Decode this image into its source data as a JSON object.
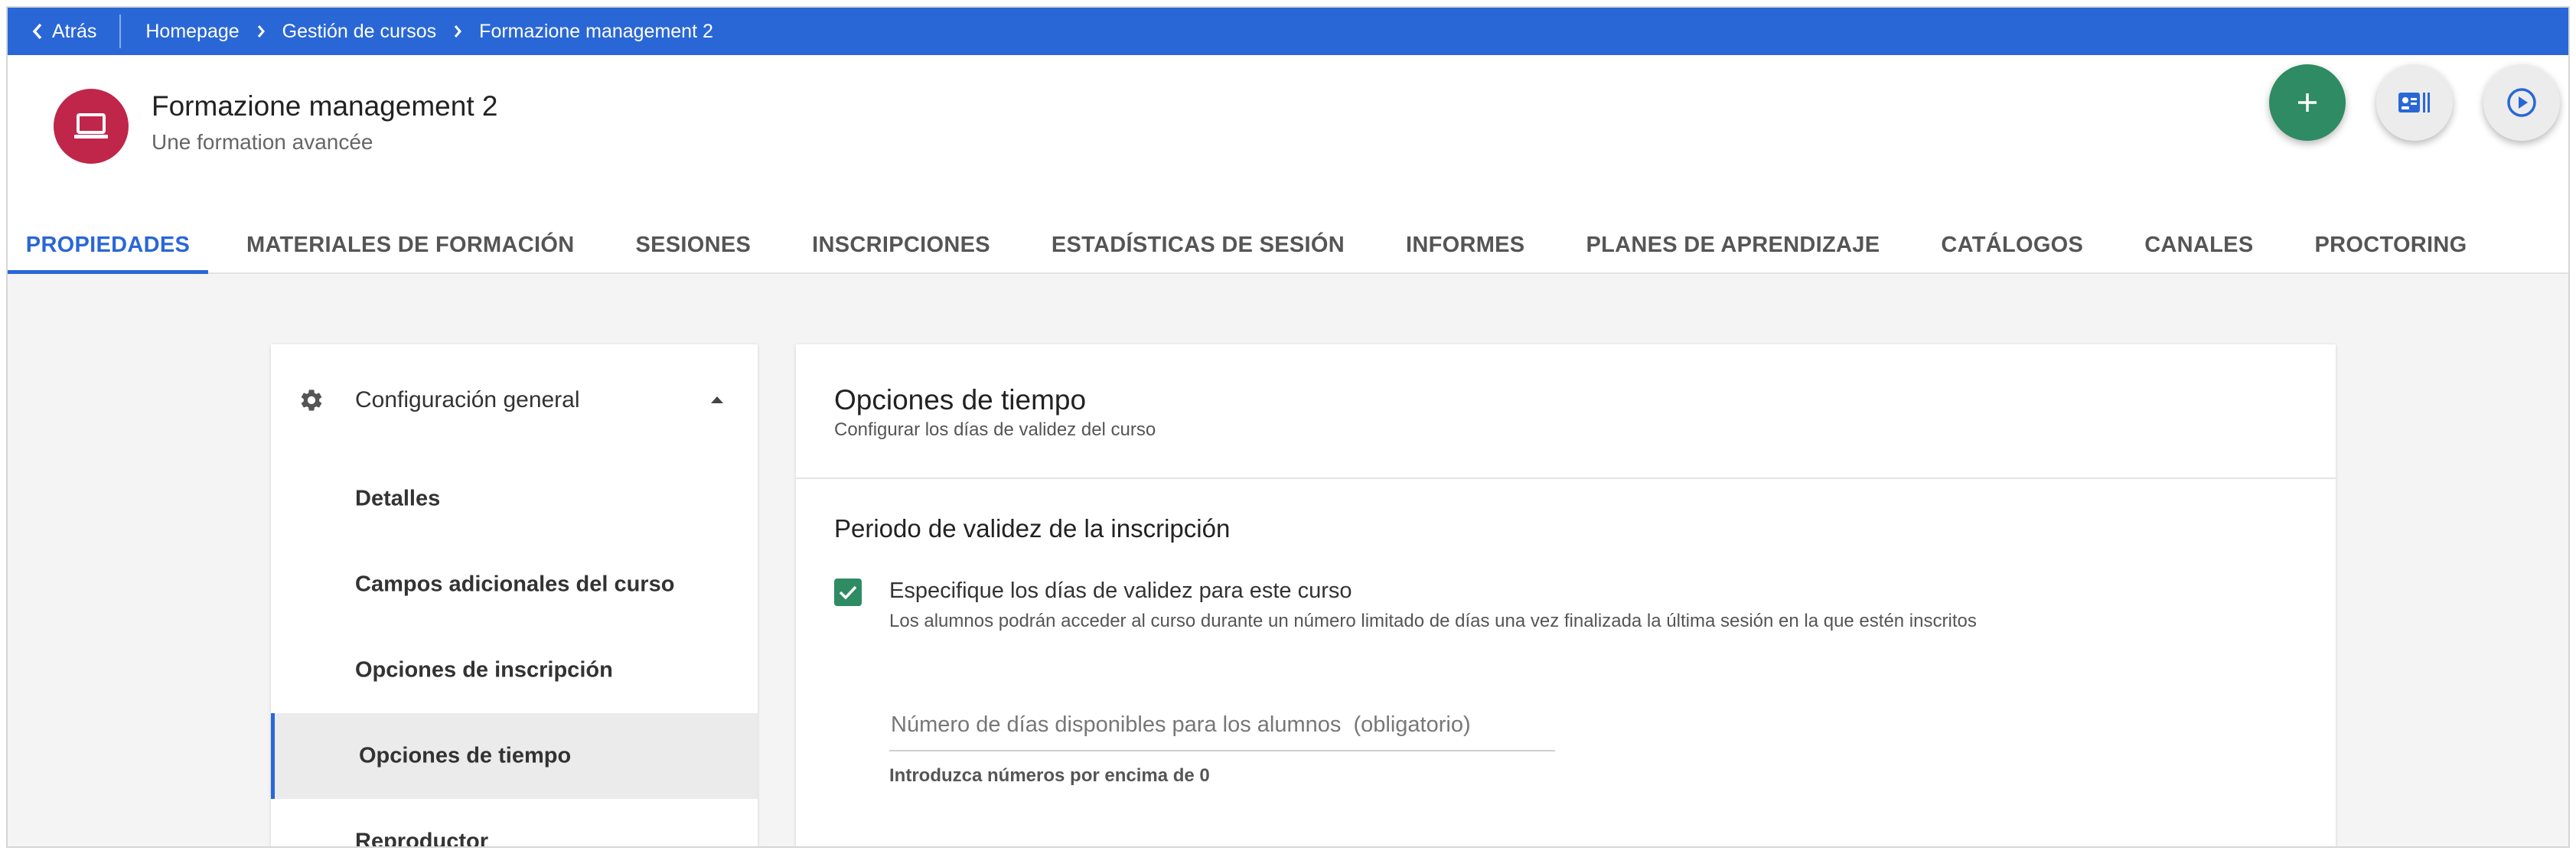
{
  "breadcrumb": {
    "back_label": "Atrás",
    "items": [
      "Homepage",
      "Gestión de cursos",
      "Formazione management 2"
    ]
  },
  "course": {
    "title": "Formazione management 2",
    "subtitle": "Une formation avancée",
    "icon": "laptop-icon",
    "icon_color": "#c0264a"
  },
  "actions": [
    {
      "name": "add-button",
      "icon": "plus-icon",
      "color": "#2e8b63"
    },
    {
      "name": "cards-view-button",
      "icon": "id-card-icon"
    },
    {
      "name": "play-button",
      "icon": "play-circle-icon"
    }
  ],
  "tabs": [
    {
      "label": "PROPIEDADES",
      "active": true
    },
    {
      "label": "MATERIALES DE FORMACIÓN"
    },
    {
      "label": "SESIONES"
    },
    {
      "label": "INSCRIPCIONES"
    },
    {
      "label": "ESTADÍSTICAS DE SESIÓN"
    },
    {
      "label": "INFORMES"
    },
    {
      "label": "PLANES DE APRENDIZAJE"
    },
    {
      "label": "CATÁLOGOS"
    },
    {
      "label": "CANALES"
    },
    {
      "label": "PROCTORING"
    }
  ],
  "sidebar": {
    "section_label": "Configuración general",
    "items": [
      {
        "label": "Detalles"
      },
      {
        "label": "Campos adicionales del curso"
      },
      {
        "label": "Opciones de inscripción"
      },
      {
        "label": "Opciones de tiempo",
        "active": true
      },
      {
        "label": "Reproductor"
      }
    ]
  },
  "main": {
    "title": "Opciones de tiempo",
    "subtitle": "Configurar los días de validez del curso",
    "section_title": "Periodo de validez de la inscripción",
    "checkbox": {
      "checked": true,
      "label": "Especifique los días de validez para este curso",
      "description": "Los alumnos podrán acceder al curso durante un número limitado de días una vez finalizada la última sesión en la que estén inscritos"
    },
    "days_field": {
      "value": "",
      "placeholder": "Número de días disponibles para los alumnos  (obligatorio)",
      "hint": "Introduzca números por encima de 0"
    }
  },
  "colors": {
    "primary": "#2a67d6",
    "success": "#2e8b63",
    "course": "#c0264a"
  }
}
